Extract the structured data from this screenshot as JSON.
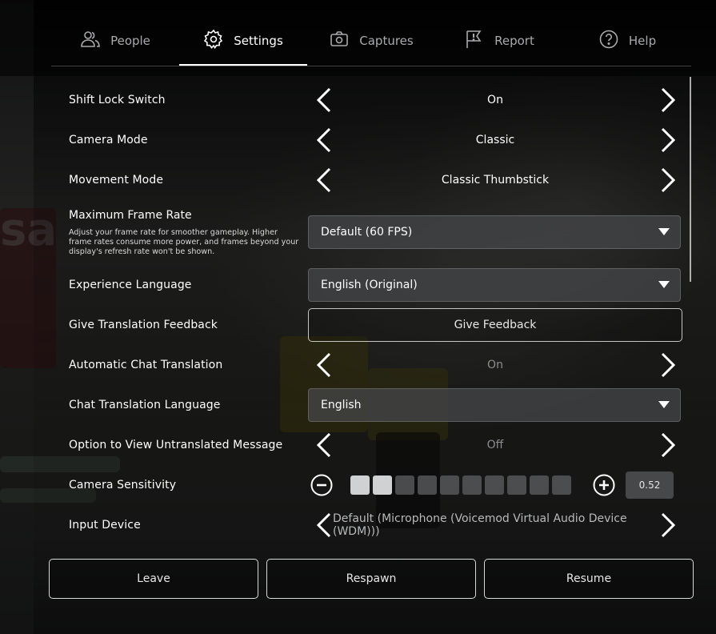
{
  "tabs": [
    {
      "label": "People",
      "icon": "people-icon"
    },
    {
      "label": "Settings",
      "icon": "gear-icon"
    },
    {
      "label": "Captures",
      "icon": "camera-icon"
    },
    {
      "label": "Report",
      "icon": "report-flag-icon"
    },
    {
      "label": "Help",
      "icon": "help-icon"
    }
  ],
  "active_tab": "Settings",
  "settings": {
    "shift_lock": {
      "label": "Shift Lock Switch",
      "value": "On"
    },
    "camera_mode": {
      "label": "Camera Mode",
      "value": "Classic"
    },
    "movement_mode": {
      "label": "Movement Mode",
      "value": "Classic Thumbstick"
    },
    "max_frame_rate": {
      "label": "Maximum Frame Rate",
      "description": "Adjust your frame rate for smoother gameplay. Higher frame rates consume more power, and frames beyond your display's refresh rate won't be shown.",
      "value": "Default (60 FPS)"
    },
    "experience_language": {
      "label": "Experience Language",
      "value": "English (Original)"
    },
    "translation_feedback": {
      "label": "Give Translation Feedback",
      "button": "Give Feedback"
    },
    "auto_chat_translation": {
      "label": "Automatic Chat Translation",
      "value": "On"
    },
    "chat_translation_language": {
      "label": "Chat Translation Language",
      "value": "English"
    },
    "untranslated_message": {
      "label": "Option to View Untranslated Message",
      "value": "Off"
    },
    "camera_sensitivity": {
      "label": "Camera Sensitivity",
      "value": "0.52",
      "filled_segments": 2,
      "total_segments": 10
    },
    "input_device": {
      "label": "Input Device",
      "value": "Default (Microphone (Voicemod Virtual Audio Device (WDM)))"
    }
  },
  "bottom": {
    "leave": "Leave",
    "respawn": "Respawn",
    "resume": "Resume"
  },
  "colors": {
    "text_active": "#ffffff",
    "text_inactive": "#a9aaac",
    "slider_on": "#d0d1d2",
    "slider_off": "#5a5b5e"
  }
}
